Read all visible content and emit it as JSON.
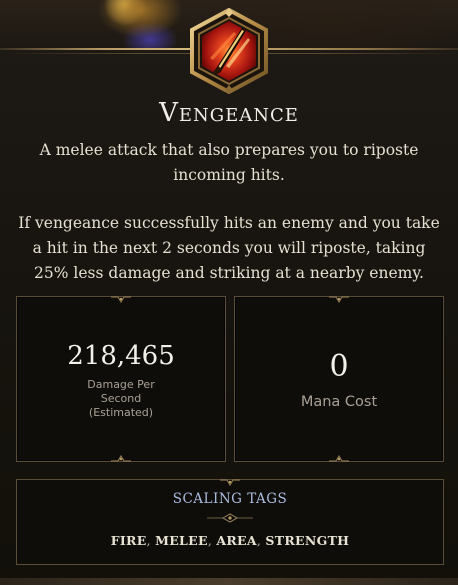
{
  "skill": {
    "name": "Vengeance",
    "icon": "crossed-swords-fire-icon",
    "description": "A melee attack that also prepares you to riposte incoming hits.",
    "effect": "If vengeance successfully hits an enemy and you take a hit in the next 2 seconds you will riposte, taking 25% less damage and striking at a nearby enemy."
  },
  "stats": {
    "damage": {
      "value": "218,465",
      "label_line1": "Damage Per",
      "label_line2": "Second",
      "label_line3": "(Estimated)"
    },
    "mana": {
      "value": "0",
      "label": "Mana Cost"
    }
  },
  "scaling": {
    "title": "SCALING TAGS",
    "tags": [
      "FIRE",
      "MELEE",
      "AREA",
      "STRENGTH"
    ]
  },
  "colors": {
    "gold_frame": "#b79a63",
    "icon_red": "#c8251b",
    "tag_title": "#a9bcdf"
  }
}
